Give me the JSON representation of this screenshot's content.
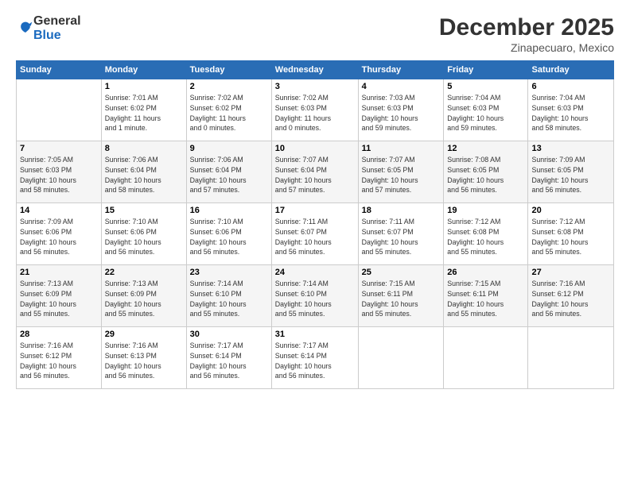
{
  "logo": {
    "general": "General",
    "blue": "Blue"
  },
  "header": {
    "title": "December 2025",
    "location": "Zinapecuaro, Mexico"
  },
  "weekdays": [
    "Sunday",
    "Monday",
    "Tuesday",
    "Wednesday",
    "Thursday",
    "Friday",
    "Saturday"
  ],
  "weeks": [
    [
      {
        "day": "",
        "info": ""
      },
      {
        "day": "1",
        "info": "Sunrise: 7:01 AM\nSunset: 6:02 PM\nDaylight: 11 hours\nand 1 minute."
      },
      {
        "day": "2",
        "info": "Sunrise: 7:02 AM\nSunset: 6:02 PM\nDaylight: 11 hours\nand 0 minutes."
      },
      {
        "day": "3",
        "info": "Sunrise: 7:02 AM\nSunset: 6:03 PM\nDaylight: 11 hours\nand 0 minutes."
      },
      {
        "day": "4",
        "info": "Sunrise: 7:03 AM\nSunset: 6:03 PM\nDaylight: 10 hours\nand 59 minutes."
      },
      {
        "day": "5",
        "info": "Sunrise: 7:04 AM\nSunset: 6:03 PM\nDaylight: 10 hours\nand 59 minutes."
      },
      {
        "day": "6",
        "info": "Sunrise: 7:04 AM\nSunset: 6:03 PM\nDaylight: 10 hours\nand 58 minutes."
      }
    ],
    [
      {
        "day": "7",
        "info": "Sunrise: 7:05 AM\nSunset: 6:03 PM\nDaylight: 10 hours\nand 58 minutes."
      },
      {
        "day": "8",
        "info": "Sunrise: 7:06 AM\nSunset: 6:04 PM\nDaylight: 10 hours\nand 58 minutes."
      },
      {
        "day": "9",
        "info": "Sunrise: 7:06 AM\nSunset: 6:04 PM\nDaylight: 10 hours\nand 57 minutes."
      },
      {
        "day": "10",
        "info": "Sunrise: 7:07 AM\nSunset: 6:04 PM\nDaylight: 10 hours\nand 57 minutes."
      },
      {
        "day": "11",
        "info": "Sunrise: 7:07 AM\nSunset: 6:05 PM\nDaylight: 10 hours\nand 57 minutes."
      },
      {
        "day": "12",
        "info": "Sunrise: 7:08 AM\nSunset: 6:05 PM\nDaylight: 10 hours\nand 56 minutes."
      },
      {
        "day": "13",
        "info": "Sunrise: 7:09 AM\nSunset: 6:05 PM\nDaylight: 10 hours\nand 56 minutes."
      }
    ],
    [
      {
        "day": "14",
        "info": "Sunrise: 7:09 AM\nSunset: 6:06 PM\nDaylight: 10 hours\nand 56 minutes."
      },
      {
        "day": "15",
        "info": "Sunrise: 7:10 AM\nSunset: 6:06 PM\nDaylight: 10 hours\nand 56 minutes."
      },
      {
        "day": "16",
        "info": "Sunrise: 7:10 AM\nSunset: 6:06 PM\nDaylight: 10 hours\nand 56 minutes."
      },
      {
        "day": "17",
        "info": "Sunrise: 7:11 AM\nSunset: 6:07 PM\nDaylight: 10 hours\nand 56 minutes."
      },
      {
        "day": "18",
        "info": "Sunrise: 7:11 AM\nSunset: 6:07 PM\nDaylight: 10 hours\nand 55 minutes."
      },
      {
        "day": "19",
        "info": "Sunrise: 7:12 AM\nSunset: 6:08 PM\nDaylight: 10 hours\nand 55 minutes."
      },
      {
        "day": "20",
        "info": "Sunrise: 7:12 AM\nSunset: 6:08 PM\nDaylight: 10 hours\nand 55 minutes."
      }
    ],
    [
      {
        "day": "21",
        "info": "Sunrise: 7:13 AM\nSunset: 6:09 PM\nDaylight: 10 hours\nand 55 minutes."
      },
      {
        "day": "22",
        "info": "Sunrise: 7:13 AM\nSunset: 6:09 PM\nDaylight: 10 hours\nand 55 minutes."
      },
      {
        "day": "23",
        "info": "Sunrise: 7:14 AM\nSunset: 6:10 PM\nDaylight: 10 hours\nand 55 minutes."
      },
      {
        "day": "24",
        "info": "Sunrise: 7:14 AM\nSunset: 6:10 PM\nDaylight: 10 hours\nand 55 minutes."
      },
      {
        "day": "25",
        "info": "Sunrise: 7:15 AM\nSunset: 6:11 PM\nDaylight: 10 hours\nand 55 minutes."
      },
      {
        "day": "26",
        "info": "Sunrise: 7:15 AM\nSunset: 6:11 PM\nDaylight: 10 hours\nand 55 minutes."
      },
      {
        "day": "27",
        "info": "Sunrise: 7:16 AM\nSunset: 6:12 PM\nDaylight: 10 hours\nand 56 minutes."
      }
    ],
    [
      {
        "day": "28",
        "info": "Sunrise: 7:16 AM\nSunset: 6:12 PM\nDaylight: 10 hours\nand 56 minutes."
      },
      {
        "day": "29",
        "info": "Sunrise: 7:16 AM\nSunset: 6:13 PM\nDaylight: 10 hours\nand 56 minutes."
      },
      {
        "day": "30",
        "info": "Sunrise: 7:17 AM\nSunset: 6:14 PM\nDaylight: 10 hours\nand 56 minutes."
      },
      {
        "day": "31",
        "info": "Sunrise: 7:17 AM\nSunset: 6:14 PM\nDaylight: 10 hours\nand 56 minutes."
      },
      {
        "day": "",
        "info": ""
      },
      {
        "day": "",
        "info": ""
      },
      {
        "day": "",
        "info": ""
      }
    ]
  ]
}
